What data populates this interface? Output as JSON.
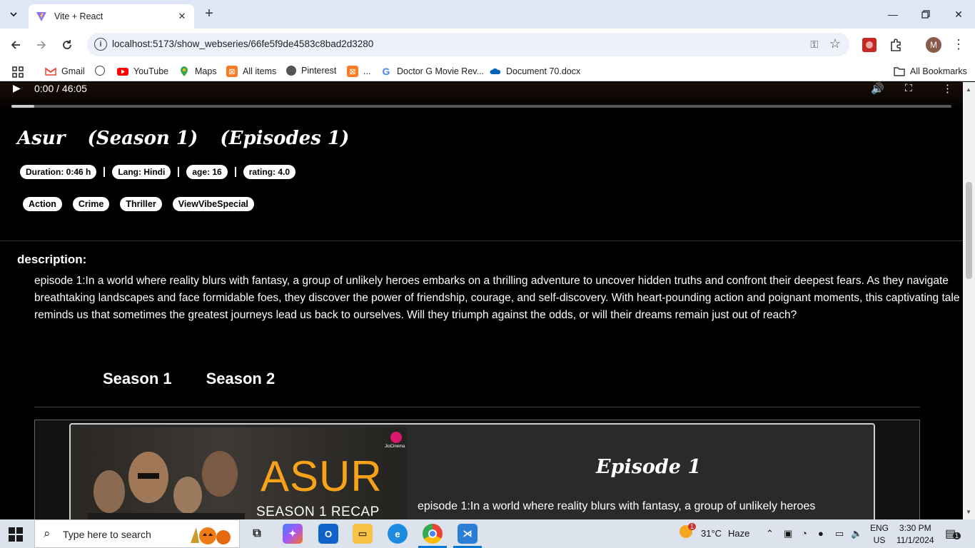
{
  "browser": {
    "tab_title": "Vite + React",
    "url": "localhost:5173/show_webseries/66fe5f9de4583c8bad2d3280",
    "profile_initial": "M",
    "bookmarks": [
      {
        "label": "Gmail",
        "icon": "gmail-icon"
      },
      {
        "label": "",
        "icon": "globe-icon"
      },
      {
        "label": "YouTube",
        "icon": "youtube-icon"
      },
      {
        "label": "Maps",
        "icon": "maps-icon"
      },
      {
        "label": "All items",
        "icon": "xampp-icon"
      },
      {
        "label": "Pinterest",
        "icon": "globe-icon"
      },
      {
        "label": "...",
        "icon": "xampp-icon"
      },
      {
        "label": "Doctor G Movie Rev...",
        "icon": "google-icon"
      },
      {
        "label": "Document 70.docx",
        "icon": "onedrive-icon"
      }
    ],
    "all_bookmarks": "All Bookmarks"
  },
  "video": {
    "time": "0:00 / 46:05",
    "progress_fraction": 0.024
  },
  "show": {
    "name": "Asur",
    "season": "(Season 1)",
    "episodes": "(Episodes 1)",
    "duration": "Duration: 0:46 h",
    "lang": "Lang: Hindi",
    "age": "age: 16",
    "rating": "rating: 4.0",
    "genres": [
      "Action",
      "Crime",
      "Thriller",
      "ViewVibeSpecial"
    ],
    "description_label": "description:",
    "description": "episode 1:In a world where reality blurs with fantasy, a group of unlikely heroes embarks on a thrilling adventure to uncover hidden truths and confront their deepest fears. As they navigate breathtaking landscapes and face formidable foes, they discover the power of friendship, courage, and self-discovery. With heart-pounding action and poignant moments, this captivating tale reminds us that sometimes the greatest journeys lead us back to ourselves. Will they triumph against the odds, or will their dreams remain just out of reach?"
  },
  "seasons": [
    "Season 1",
    "Season 2"
  ],
  "episode_card": {
    "thumbnail_title": "ASUR",
    "thumbnail_subtitle": "SEASON 1 RECAP",
    "thumbnail_logo_text": "JioCinema",
    "title": "Episode 1",
    "description": "episode 1:In a world where reality blurs with fantasy, a group of unlikely heroes"
  },
  "taskbar": {
    "search_placeholder": "Type here to search",
    "weather_temp": "31°C",
    "weather_desc": "Haze",
    "weather_badge": "1",
    "lang_top": "ENG",
    "lang_bottom": "US",
    "time": "3:30 PM",
    "date": "11/1/2024",
    "notification_count": "1"
  }
}
